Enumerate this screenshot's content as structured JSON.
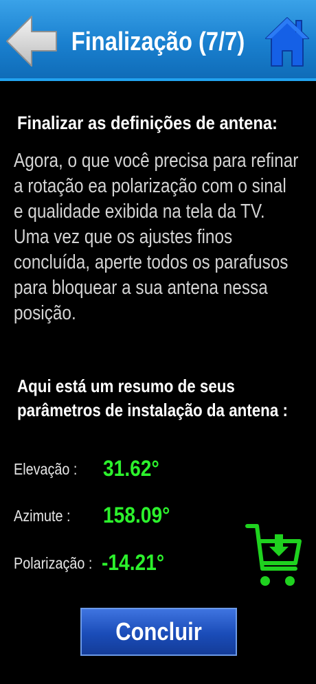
{
  "header": {
    "title": "Finalização (7/7)",
    "back_icon": "back-arrow-icon",
    "home_icon": "home-icon"
  },
  "main": {
    "section_title": "Finalizar as definições de antena:",
    "paragraph": [
      "Agora, o que você precisa para refinar",
      "a rotação ea polarização com o sinal",
      "e qualidade exibida na tela da TV.",
      "Uma vez que os ajustes finos",
      "concluída, aperte todos os parafusos",
      "para bloquear a sua antena nessa",
      "posição."
    ],
    "summary_title": [
      "Aqui está um resumo de seus",
      "parâmetros de instalação da antena :"
    ],
    "params": [
      {
        "label": "Elevação :",
        "value": "31.62°"
      },
      {
        "label": "Azimute :",
        "value": "158.09°"
      },
      {
        "label": "Polarização :",
        "value": "-14.21°"
      }
    ],
    "cart_icon": "shopping-cart-icon"
  },
  "footer": {
    "conclude_label": "Concluir"
  },
  "colors": {
    "header_blue": "#1a80cf",
    "value_green": "#2cf22c",
    "button_blue": "#1a4cb8"
  }
}
